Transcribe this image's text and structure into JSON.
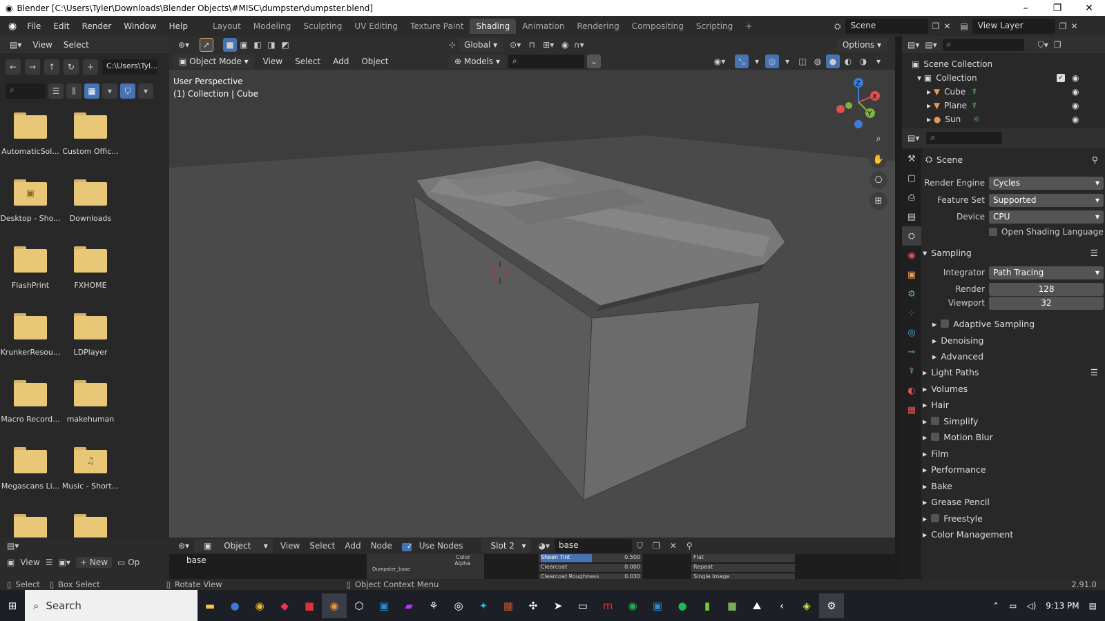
{
  "window": {
    "title": "Blender [C:\\Users\\Tyler\\Downloads\\Blender Objects\\#MISC\\dumpster\\dumpster.blend]"
  },
  "menubar": {
    "items": [
      "File",
      "Edit",
      "Render",
      "Window",
      "Help"
    ]
  },
  "workspaces": [
    "Layout",
    "Modeling",
    "Sculpting",
    "UV Editing",
    "Texture Paint",
    "Shading",
    "Animation",
    "Rendering",
    "Compositing",
    "Scripting"
  ],
  "active_workspace": "Shading",
  "scene_field": "Scene",
  "view_layer_field": "View Layer",
  "file_browser": {
    "header": [
      "View",
      "Select"
    ],
    "path": "C:\\Users\\Tyl...",
    "items": [
      "AutomaticSol...",
      "Custom Offic...",
      "Desktop - Sho...",
      "Downloads",
      "FlashPrint",
      "FXHOME",
      "KrunkerResou...",
      "LDPlayer",
      "Macro Record...",
      "makehuman",
      "Megascans Li...",
      "Music - Short..."
    ],
    "bottom": {
      "view": "View",
      "new": "New",
      "open": "Op"
    }
  },
  "viewport": {
    "transform": "Global",
    "options": "Options",
    "mode": "Object Mode",
    "menus": [
      "View",
      "Select",
      "Add",
      "Object"
    ],
    "collection_filter": "Models",
    "perspective": "User Perspective",
    "context": "(1) Collection | Cube",
    "gizmo": {
      "x": "X",
      "y": "Y",
      "z": "Z"
    }
  },
  "node_editor": {
    "type": "Object",
    "menus": [
      "View",
      "Select",
      "Add",
      "Node"
    ],
    "use_nodes": "Use Nodes",
    "slot": "Slot 2",
    "material": "base",
    "label": "base",
    "socket_labels": [
      "Color",
      "Alpha"
    ],
    "node_title": "Dumpster_base",
    "fields": [
      {
        "name": "Sheen Tint",
        "value": "0.500"
      },
      {
        "name": "Clearcoat",
        "value": "0.000"
      },
      {
        "name": "Clearcoat Roughness",
        "value": "0.030"
      }
    ],
    "fields_right": [
      "Flat",
      "Repeat",
      "Single Image"
    ]
  },
  "outliner": {
    "root": "Scene Collection",
    "collection": "Collection",
    "objects": [
      "Cube",
      "Plane",
      "Sun"
    ]
  },
  "properties": {
    "context": "Scene",
    "render_engine_label": "Render Engine",
    "render_engine": "Cycles",
    "feature_set_label": "Feature Set",
    "feature_set": "Supported",
    "device_label": "Device",
    "device": "CPU",
    "osl": "Open Shading Language",
    "sampling": "Sampling",
    "integrator_label": "Integrator",
    "integrator": "Path Tracing",
    "render_label": "Render",
    "render": "128",
    "viewport_label": "Viewport",
    "viewport": "32",
    "subsections": [
      "Adaptive Sampling",
      "Denoising",
      "Advanced"
    ],
    "sections": [
      "Light Paths",
      "Volumes",
      "Hair",
      "Simplify",
      "Motion Blur",
      "Film",
      "Performance",
      "Bake",
      "Grease Pencil",
      "Freestyle",
      "Color Management"
    ]
  },
  "status_bar": {
    "select": "Select",
    "box_select": "Box Select",
    "rotate": "Rotate View",
    "context_menu": "Object Context Menu",
    "version": "2.91.0"
  },
  "taskbar": {
    "search": "Search",
    "time": "9:13 PM"
  },
  "colors": {
    "accent": "#4772b3",
    "active_tab": "#474747",
    "folder": "#e8c776"
  }
}
